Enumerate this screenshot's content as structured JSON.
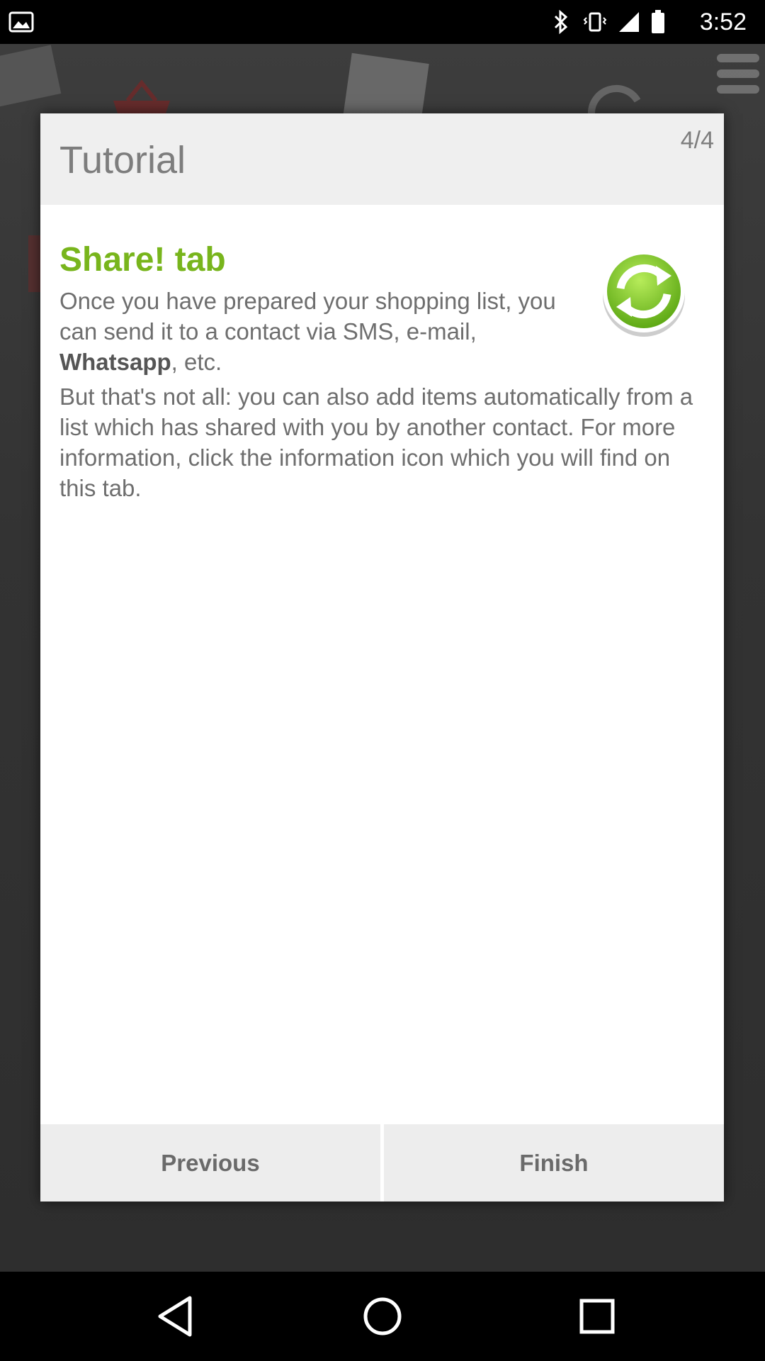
{
  "status_bar": {
    "time": "3:52",
    "icons": [
      "bluetooth-icon",
      "vibrate-icon",
      "signal-icon",
      "battery-icon"
    ]
  },
  "dialog": {
    "title": "Tutorial",
    "page_indicator": "4/4",
    "section_heading": "Share! tab",
    "section_icon": "refresh-icon",
    "paragraph1": {
      "before": "Once you have prepared your shopping list, you can send it to a contact via SMS, e-mail, ",
      "bold": "Whatsapp",
      "after": ", etc."
    },
    "paragraph2": "But that's not all: you can also add items automatically from a list which has shared with you by another contact. For more information, click the information icon which you will find on this tab.",
    "buttons": {
      "previous": "Previous",
      "finish": "Finish"
    }
  },
  "nav_bar": {
    "icons": [
      "back-icon",
      "home-icon",
      "recents-icon"
    ]
  },
  "colors": {
    "accent_green": "#78b51c",
    "header_bg": "#efefef",
    "body_text": "#6e6e6e"
  }
}
